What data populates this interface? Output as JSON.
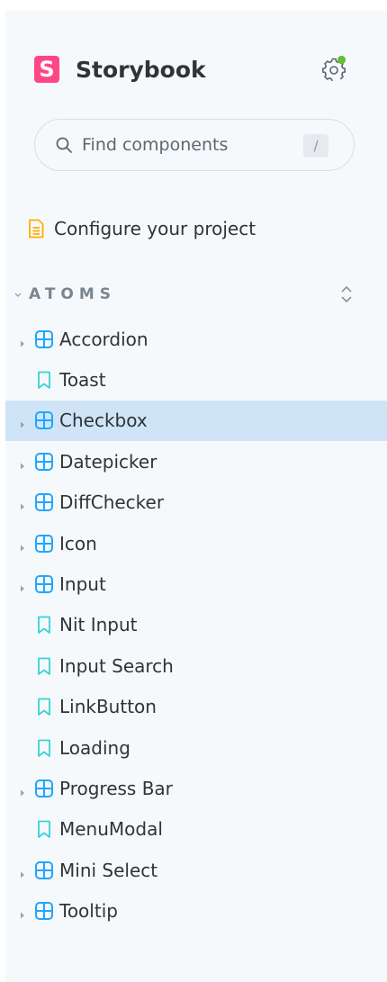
{
  "brand": {
    "logo_letter": "S",
    "name": "Storybook"
  },
  "search": {
    "placeholder": "Find components",
    "shortcut": "/"
  },
  "configure": {
    "label": "Configure your project"
  },
  "section": {
    "title": "ATOMS"
  },
  "colors": {
    "brand": "#ff4785",
    "component_icon": "#1ea7fd",
    "story_icon": "#37d5d3",
    "docs_icon": "#ffae00",
    "status_dot": "#66bf3c",
    "selected_bg": "#cfe5f7"
  },
  "tree": {
    "items": [
      {
        "label": "Accordion",
        "type": "component",
        "icon": "component-icon",
        "expandable": true,
        "selected": false
      },
      {
        "label": "Toast",
        "type": "story",
        "icon": "bookmark-icon",
        "expandable": false,
        "selected": false
      },
      {
        "label": "Checkbox",
        "type": "component",
        "icon": "component-icon",
        "expandable": true,
        "selected": true
      },
      {
        "label": "Datepicker",
        "type": "component",
        "icon": "component-icon",
        "expandable": true,
        "selected": false
      },
      {
        "label": "DiffChecker",
        "type": "component",
        "icon": "component-icon",
        "expandable": true,
        "selected": false
      },
      {
        "label": "Icon",
        "type": "component",
        "icon": "component-icon",
        "expandable": true,
        "selected": false
      },
      {
        "label": "Input",
        "type": "component",
        "icon": "component-icon",
        "expandable": true,
        "selected": false
      },
      {
        "label": "Nit Input",
        "type": "story",
        "icon": "bookmark-icon",
        "expandable": false,
        "selected": false
      },
      {
        "label": "Input Search",
        "type": "story",
        "icon": "bookmark-icon",
        "expandable": false,
        "selected": false
      },
      {
        "label": "LinkButton",
        "type": "story",
        "icon": "bookmark-icon",
        "expandable": false,
        "selected": false
      },
      {
        "label": "Loading",
        "type": "story",
        "icon": "bookmark-icon",
        "expandable": false,
        "selected": false
      },
      {
        "label": "Progress Bar",
        "type": "component",
        "icon": "component-icon",
        "expandable": true,
        "selected": false
      },
      {
        "label": "MenuModal",
        "type": "story",
        "icon": "bookmark-icon",
        "expandable": false,
        "selected": false
      },
      {
        "label": "Mini Select",
        "type": "component",
        "icon": "component-icon",
        "expandable": true,
        "selected": false
      },
      {
        "label": "Tooltip",
        "type": "component",
        "icon": "component-icon",
        "expandable": true,
        "selected": false
      }
    ]
  }
}
